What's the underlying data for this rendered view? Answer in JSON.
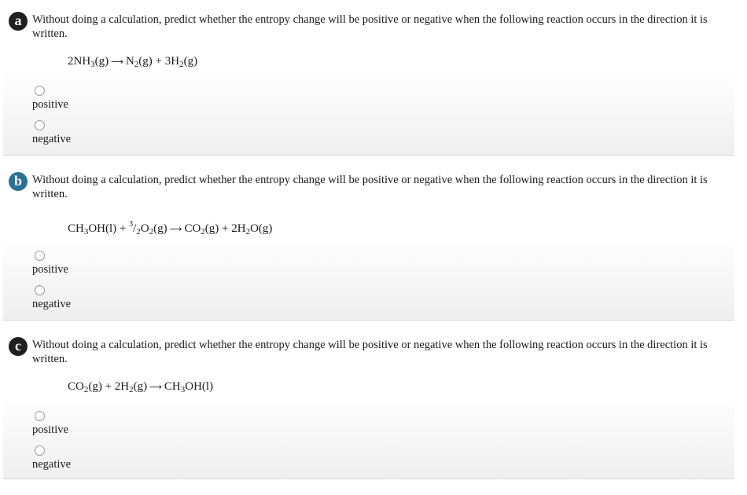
{
  "colors": {
    "badge_a": "#1f1f1f",
    "badge_b": "#2d6f95",
    "badge_c": "#1f1f1f"
  },
  "questions": [
    {
      "badge": "a",
      "prompt": "Without doing a calculation, predict whether the entropy change will be positive or negative when the following reaction occurs in the direction it is written.",
      "equation": {
        "lhs": [
          "2NH",
          "3",
          "(g)"
        ],
        "arrow": "⟶",
        "rhs": [
          "N",
          "2",
          "(g) + 3H",
          "2",
          "(g)"
        ]
      },
      "options": [
        "positive",
        "negative"
      ]
    },
    {
      "badge": "b",
      "prompt": "Without doing a calculation, predict whether the entropy change will be positive or negative when the following reaction occurs in the direction it is written.",
      "equation": {
        "lhs": [
          "CH",
          "3",
          "OH(l) + ",
          "3",
          "/",
          "2",
          "O",
          "2",
          "(g)"
        ],
        "arrow": "⟶",
        "rhs": [
          "CO",
          "2",
          "(g) + 2H",
          "2",
          "O(g)"
        ]
      },
      "options": [
        "positive",
        "negative"
      ]
    },
    {
      "badge": "c",
      "prompt": "Without doing a calculation, predict whether the entropy change will be positive or negative when the following reaction occurs in the direction it is written.",
      "equation": {
        "lhs": [
          "CO",
          "2",
          "(g) + 2H",
          "2",
          "(g)"
        ],
        "arrow": "⟶",
        "rhs": [
          "CH",
          "3",
          "OH(l)"
        ]
      },
      "options": [
        "positive",
        "negative"
      ]
    }
  ]
}
